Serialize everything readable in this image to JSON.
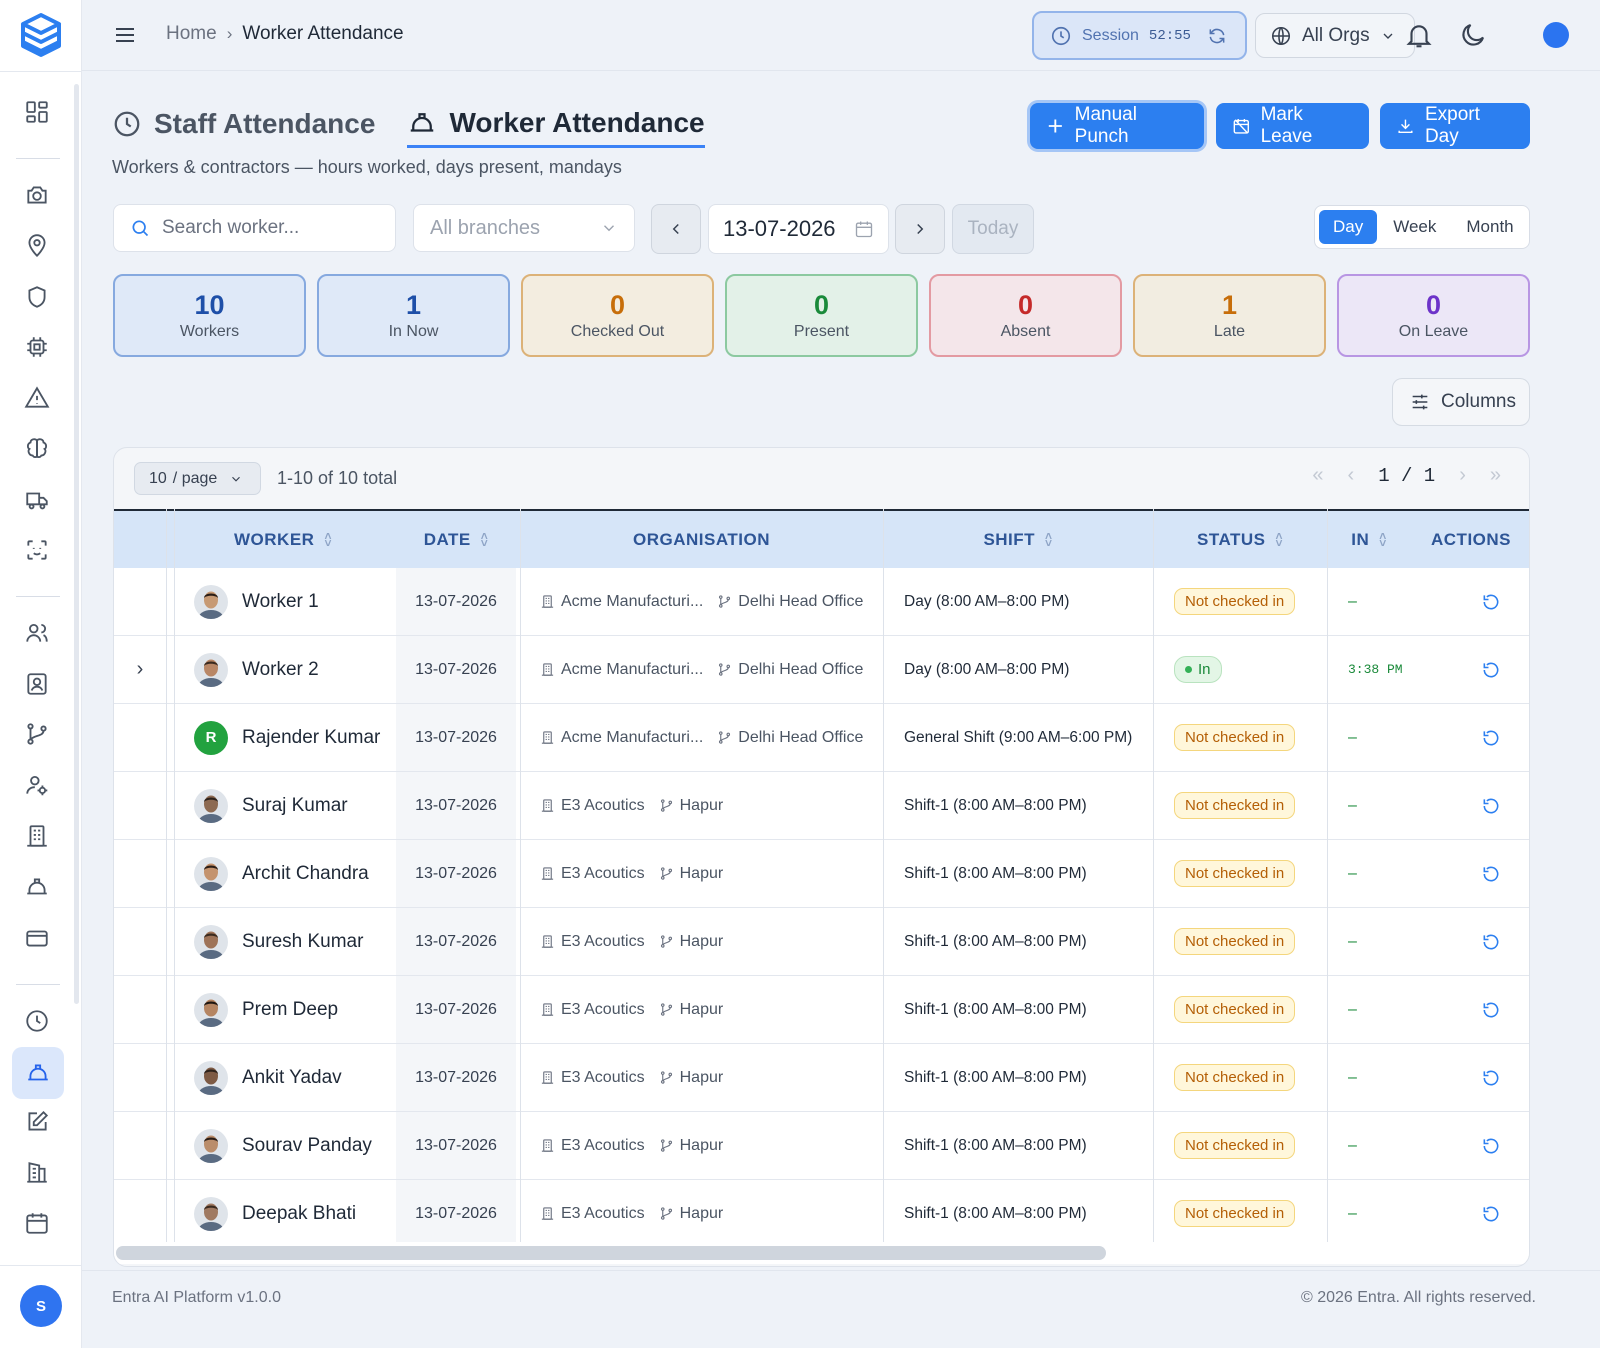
{
  "header": {
    "breadcrumb": [
      "Home",
      "Worker Attendance"
    ],
    "session_label": "Session",
    "session_time": "52:55",
    "orgs_label": "All Orgs"
  },
  "tabs": [
    {
      "label": "Staff Attendance",
      "icon": "clock-icon"
    },
    {
      "label": "Worker Attendance",
      "icon": "hard-hat-icon",
      "active": true
    }
  ],
  "subtitle": "Workers & contractors — hours worked, days present, mandays",
  "actions": {
    "manual_punch": "Manual Punch",
    "mark_leave": "Mark Leave",
    "export_day": "Export Day"
  },
  "filters": {
    "search_placeholder": "Search worker...",
    "branch_placeholder": "All branches",
    "date": "13-07-2026",
    "today": "Today",
    "views": [
      "Day",
      "Week",
      "Month"
    ],
    "active_view": "Day"
  },
  "stats": [
    {
      "value": "10",
      "label": "Workers",
      "color": "#1e4fa8"
    },
    {
      "value": "1",
      "label": "In Now",
      "color": "#1e4fa8"
    },
    {
      "value": "0",
      "label": "Checked Out",
      "color": "#c76e0a"
    },
    {
      "value": "0",
      "label": "Present",
      "color": "#1a8a3a"
    },
    {
      "value": "0",
      "label": "Absent",
      "color": "#c52a2a"
    },
    {
      "value": "1",
      "label": "Late",
      "color": "#c76e0a"
    },
    {
      "value": "0",
      "label": "On Leave",
      "color": "#6d33c9"
    }
  ],
  "columns_btn": "Columns",
  "table": {
    "page_size": "10",
    "page_suffix": "/ page",
    "total": "1-10 of 10 total",
    "page": "1 / 1",
    "headers": {
      "worker": "WORKER",
      "date": "DATE",
      "organisation": "ORGANISATION",
      "shift": "SHIFT",
      "status": "STATUS",
      "in": "IN",
      "actions": "ACTIONS"
    },
    "rows": [
      {
        "name": "Worker 1",
        "date": "13-07-2026",
        "org": "Acme Manufacturi...",
        "branch": "Delhi Head Office",
        "shift": "Day (8:00 AM–8:00 PM)",
        "status": "Not checked in",
        "in": "–"
      },
      {
        "name": "Worker 2",
        "date": "13-07-2026",
        "org": "Acme Manufacturi...",
        "branch": "Delhi Head Office",
        "shift": "Day (8:00 AM–8:00 PM)",
        "status": "In",
        "in": "3:38 PM",
        "expand": true
      },
      {
        "name": "Rajender Kumar",
        "date": "13-07-2026",
        "org": "Acme Manufacturi...",
        "branch": "Delhi Head Office",
        "shift": "General Shift (9:00 AM–6:00 PM)",
        "status": "Not checked in",
        "in": "–",
        "initial": "R"
      },
      {
        "name": "Suraj Kumar",
        "date": "13-07-2026",
        "org": "E3 Acoutics",
        "branch": "Hapur",
        "shift": "Shift-1 (8:00 AM–8:00 PM)",
        "status": "Not checked in",
        "in": "–"
      },
      {
        "name": "Archit Chandra",
        "date": "13-07-2026",
        "org": "E3 Acoutics",
        "branch": "Hapur",
        "shift": "Shift-1 (8:00 AM–8:00 PM)",
        "status": "Not checked in",
        "in": "–"
      },
      {
        "name": "Suresh Kumar",
        "date": "13-07-2026",
        "org": "E3 Acoutics",
        "branch": "Hapur",
        "shift": "Shift-1 (8:00 AM–8:00 PM)",
        "status": "Not checked in",
        "in": "–"
      },
      {
        "name": "Prem Deep",
        "date": "13-07-2026",
        "org": "E3 Acoutics",
        "branch": "Hapur",
        "shift": "Shift-1 (8:00 AM–8:00 PM)",
        "status": "Not checked in",
        "in": "–"
      },
      {
        "name": "Ankit Yadav",
        "date": "13-07-2026",
        "org": "E3 Acoutics",
        "branch": "Hapur",
        "shift": "Shift-1 (8:00 AM–8:00 PM)",
        "status": "Not checked in",
        "in": "–"
      },
      {
        "name": "Sourav Panday",
        "date": "13-07-2026",
        "org": "E3 Acoutics",
        "branch": "Hapur",
        "shift": "Shift-1 (8:00 AM–8:00 PM)",
        "status": "Not checked in",
        "in": "–"
      },
      {
        "name": "Deepak Bhati",
        "date": "13-07-2026",
        "org": "E3 Acoutics",
        "branch": "Hapur",
        "shift": "Shift-1 (8:00 AM–8:00 PM)",
        "status": "Not checked in",
        "in": "–"
      }
    ]
  },
  "footer": {
    "left": "Entra AI Platform v1.0.0",
    "right": "© 2026 Entra. All rights reserved."
  },
  "user_initial": "S"
}
